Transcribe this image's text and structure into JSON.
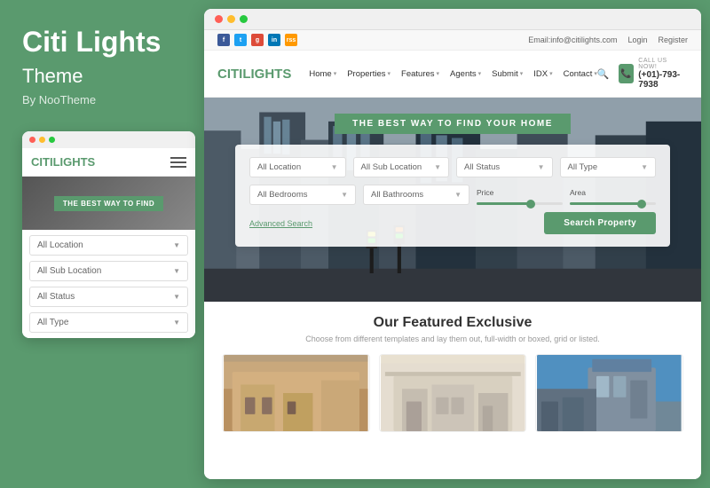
{
  "left": {
    "brand_title": "Citi Lights",
    "brand_subtitle": "Theme",
    "brand_by": "By NooTheme",
    "mobile": {
      "logo_text1": "CITI",
      "logo_text2": "LIGHTS",
      "hero_banner": "THE BEST WAY TO FIND",
      "selects": [
        {
          "label": "All Location",
          "id": "mob-location"
        },
        {
          "label": "All Sub Location",
          "id": "mob-sublocation"
        },
        {
          "label": "All Status",
          "id": "mob-status"
        },
        {
          "label": "All Type",
          "id": "mob-type"
        }
      ]
    }
  },
  "right": {
    "topbar": {
      "email": "Email:info@citilights.com",
      "login_label": "Login",
      "register_label": "Register",
      "social_icons": [
        "f",
        "t",
        "g+",
        "in",
        "rss"
      ]
    },
    "nav": {
      "logo_text1": "CITI",
      "logo_text2": "LIGHTS",
      "items": [
        {
          "label": "Home",
          "has_arrow": true
        },
        {
          "label": "Properties",
          "has_arrow": true
        },
        {
          "label": "Features",
          "has_arrow": true
        },
        {
          "label": "Agents",
          "has_arrow": true
        },
        {
          "label": "Submit",
          "has_arrow": true
        },
        {
          "label": "IDX",
          "has_arrow": true
        },
        {
          "label": "Contact",
          "has_arrow": true
        }
      ],
      "phone_label": "CALL US NOW!",
      "phone_number": "(+01)-793-7938"
    },
    "hero": {
      "banner": "THE BEST WAY TO FIND YOUR HOME",
      "form": {
        "row1": [
          {
            "label": "All Location"
          },
          {
            "label": "All Sub Location"
          },
          {
            "label": "All Status"
          },
          {
            "label": "All Type"
          }
        ],
        "row2_selects": [
          {
            "label": "All Bedrooms"
          },
          {
            "label": "All Bathrooms"
          }
        ],
        "price_label": "Price",
        "area_label": "Area",
        "advanced_search": "Advanced Search",
        "search_btn": "Search Property"
      }
    },
    "featured": {
      "title": "Our Featured Exclusive",
      "subtitle": "Choose from different templates and lay them out, full-width or boxed, grid or listed."
    }
  }
}
